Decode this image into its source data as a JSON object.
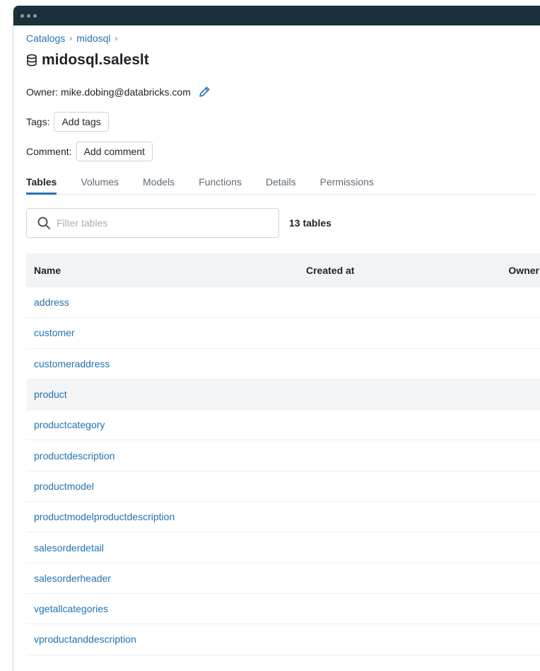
{
  "breadcrumb": {
    "items": [
      "Catalogs",
      "midosql"
    ],
    "separator": "›"
  },
  "schema": {
    "title": "midosql.saleslt",
    "icon": "database-icon"
  },
  "owner": {
    "text": "Owner: mike.dobing@databricks.com",
    "edit_icon": "pencil-icon"
  },
  "tags": {
    "label": "Tags:",
    "button": "Add tags"
  },
  "comment": {
    "label": "Comment:",
    "button": "Add comment"
  },
  "tabs": [
    {
      "label": "Tables",
      "active": true
    },
    {
      "label": "Volumes",
      "active": false
    },
    {
      "label": "Models",
      "active": false
    },
    {
      "label": "Functions",
      "active": false
    },
    {
      "label": "Details",
      "active": false
    },
    {
      "label": "Permissions",
      "active": false
    }
  ],
  "filter": {
    "placeholder": "Filter tables",
    "value": "",
    "count_label": "13 tables"
  },
  "table": {
    "columns": [
      "Name",
      "Created at",
      "Owner"
    ],
    "rows": [
      "address",
      "customer",
      "customeraddress",
      "product",
      "productcategory",
      "productdescription",
      "productmodel",
      "productmodelproductdescription",
      "salesorderdetail",
      "salesorderheader",
      "vgetallcategories",
      "vproductanddescription"
    ],
    "highlighted_row": "product"
  },
  "colors": {
    "link": "#2272b4",
    "titlebar": "#1b3139",
    "header_bg": "#f1f3f5"
  }
}
